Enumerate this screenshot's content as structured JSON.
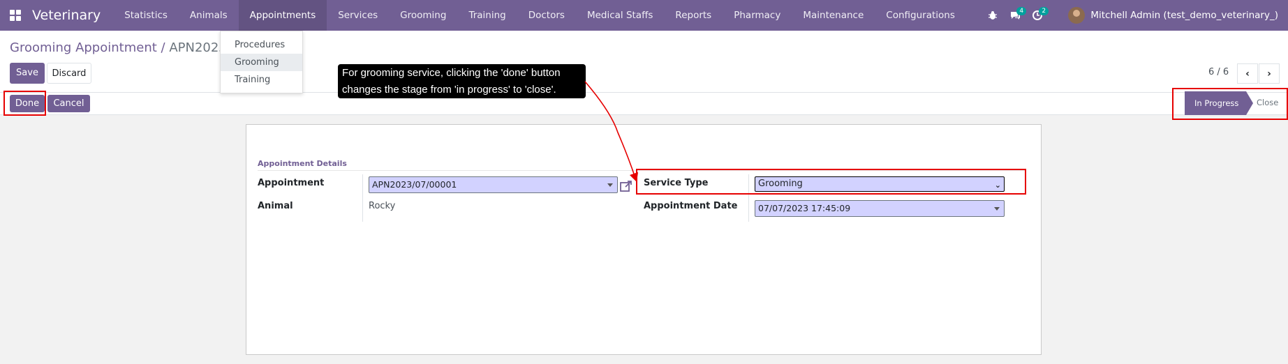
{
  "navbar": {
    "brand": "Veterinary",
    "menu": [
      "Statistics",
      "Animals",
      "Appointments",
      "Services",
      "Grooming",
      "Training",
      "Doctors",
      "Medical Staffs",
      "Reports",
      "Pharmacy",
      "Maintenance",
      "Configurations"
    ],
    "active_menu": "Appointments",
    "messages_count": "4",
    "activities_count": "2",
    "user": "Mitchell Admin (test_demo_veterinary_)"
  },
  "dropdown": {
    "items": [
      "Procedures",
      "Grooming",
      "Training"
    ],
    "active": "Grooming"
  },
  "breadcrumb": {
    "parent": "Grooming Appointment",
    "separator": " / ",
    "current": "APN2023/07/"
  },
  "control": {
    "save": "Save",
    "discard": "Discard",
    "pager": "6 / 6"
  },
  "status": {
    "done": "Done",
    "cancel": "Cancel",
    "stages": [
      "In Progress",
      "Close"
    ],
    "active_stage": "In Progress"
  },
  "tooltip": {
    "line1": "For grooming service, clicking the 'done' button",
    "line2": "changes the stage from 'in progress' to 'close'."
  },
  "form": {
    "group_title": "Appointment Details",
    "appointment_label": "Appointment",
    "appointment_value": "APN2023/07/00001",
    "animal_label": "Animal",
    "animal_value": "Rocky",
    "service_type_label": "Service Type",
    "service_type_value": "Grooming",
    "appointment_date_label": "Appointment Date",
    "appointment_date_value": "07/07/2023 17:45:09"
  },
  "colors": {
    "brand": "#715f94",
    "field_bg": "#d2d2ff",
    "annotation": "#e60000"
  }
}
